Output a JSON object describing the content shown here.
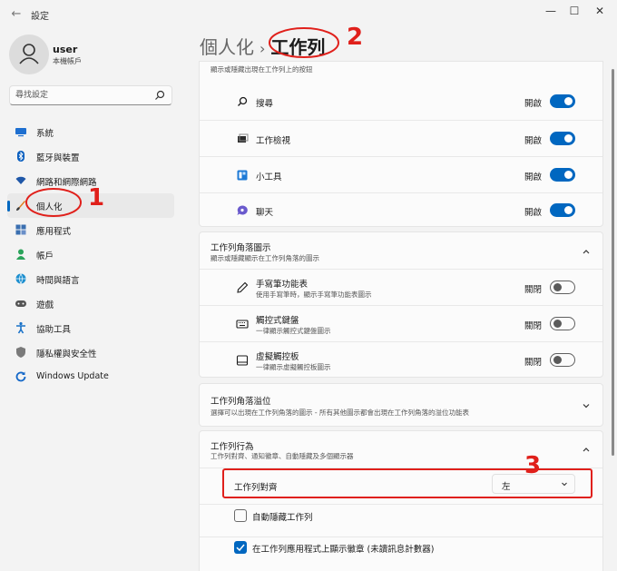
{
  "window": {
    "title": "設定",
    "controls": {
      "minimize": "—",
      "maximize": "☐",
      "close": "✕"
    },
    "back": "←"
  },
  "user": {
    "name": "user",
    "account": "本機帳戶"
  },
  "search": {
    "placeholder": "尋找設定"
  },
  "nav": {
    "items": [
      {
        "label": "系統",
        "icon": "monitor-icon",
        "color": "#1e6fd0"
      },
      {
        "label": "藍牙與裝置",
        "icon": "bluetooth-icon",
        "color": "#0a5fbf"
      },
      {
        "label": "網路和網際網路",
        "icon": "wifi-icon",
        "color": "#1f57a8"
      },
      {
        "label": "個人化",
        "icon": "brush-icon",
        "color": "#e07a18",
        "active": true
      },
      {
        "label": "應用程式",
        "icon": "apps-icon",
        "color": "#3a6fb0"
      },
      {
        "label": "帳戶",
        "icon": "person-icon",
        "color": "#2aa35a"
      },
      {
        "label": "時間與語言",
        "icon": "globe-icon",
        "color": "#1d8fcf"
      },
      {
        "label": "遊戲",
        "icon": "gamepad-icon",
        "color": "#555555"
      },
      {
        "label": "協助工具",
        "icon": "accessibility-icon",
        "color": "#1a72c8"
      },
      {
        "label": "隱私權與安全性",
        "icon": "shield-icon",
        "color": "#7a7a7a"
      },
      {
        "label": "Windows Update",
        "icon": "update-icon",
        "color": "#1568c8"
      }
    ]
  },
  "breadcrumb": {
    "parent": "個人化",
    "separator": "›",
    "current": "工作列"
  },
  "annotations": {
    "one": "1",
    "two": "2",
    "three": "3"
  },
  "accent": "#0067c0",
  "annotation_color": "#e0201b",
  "taskbar_items": {
    "clipped_desc": "顯示或隱藏出現在工作列上的按鈕",
    "rows": [
      {
        "label": "搜尋",
        "state": "開啟",
        "icon": "search-icon",
        "on": true
      },
      {
        "label": "工作檢視",
        "state": "開啟",
        "icon": "task-view-icon",
        "on": true
      },
      {
        "label": "小工具",
        "state": "開啟",
        "icon": "widgets-icon",
        "on": true
      },
      {
        "label": "聊天",
        "state": "開啟",
        "icon": "chat-icon",
        "on": true
      }
    ]
  },
  "corner_icons": {
    "title": "工作列角落圖示",
    "desc": "顯示或隱藏顯示在工作列角落的圖示",
    "rows": [
      {
        "label": "手寫筆功能表",
        "sub": "使用手寫筆時，顯示手寫筆功能表圖示",
        "state": "關閉",
        "icon": "pen-icon",
        "on": false
      },
      {
        "label": "觸控式鍵盤",
        "sub": "一律顯示觸控式鍵盤圖示",
        "state": "關閉",
        "icon": "keyboard-icon",
        "on": false
      },
      {
        "label": "虛擬觸控板",
        "sub": "一律顯示虛擬觸控板圖示",
        "state": "關閉",
        "icon": "touchpad-icon",
        "on": false
      }
    ]
  },
  "corner_overflow": {
    "title": "工作列角落溢位",
    "desc": "選擇可以出現在工作列角落的圖示 - 所有其他圖示都會出現在工作列角落的溢位功能表"
  },
  "behaviors": {
    "title": "工作列行為",
    "desc": "工作列對齊、通知徽章、自動隱藏及多個顯示器",
    "alignment": {
      "label": "工作列對齊",
      "value": "左"
    },
    "auto_hide": {
      "label": "自動隱藏工作列",
      "checked": false
    },
    "badges": {
      "label": "在工作列應用程式上顯示徽章 (未讀訊息計數器)",
      "checked": true
    }
  }
}
